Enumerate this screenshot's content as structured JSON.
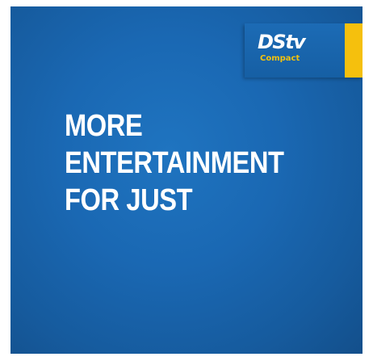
{
  "badge": {
    "brand": "DStv",
    "package": "Compact",
    "colors": {
      "background": "#1a65ad",
      "accent": "#f5c00d",
      "text": "#ffffff"
    }
  },
  "headline": {
    "lines": [
      "MORE",
      "ENTERTAINMENT",
      "FOR JUST"
    ]
  },
  "colors": {
    "panel": "#1a68b3",
    "page": "#ffffff"
  }
}
